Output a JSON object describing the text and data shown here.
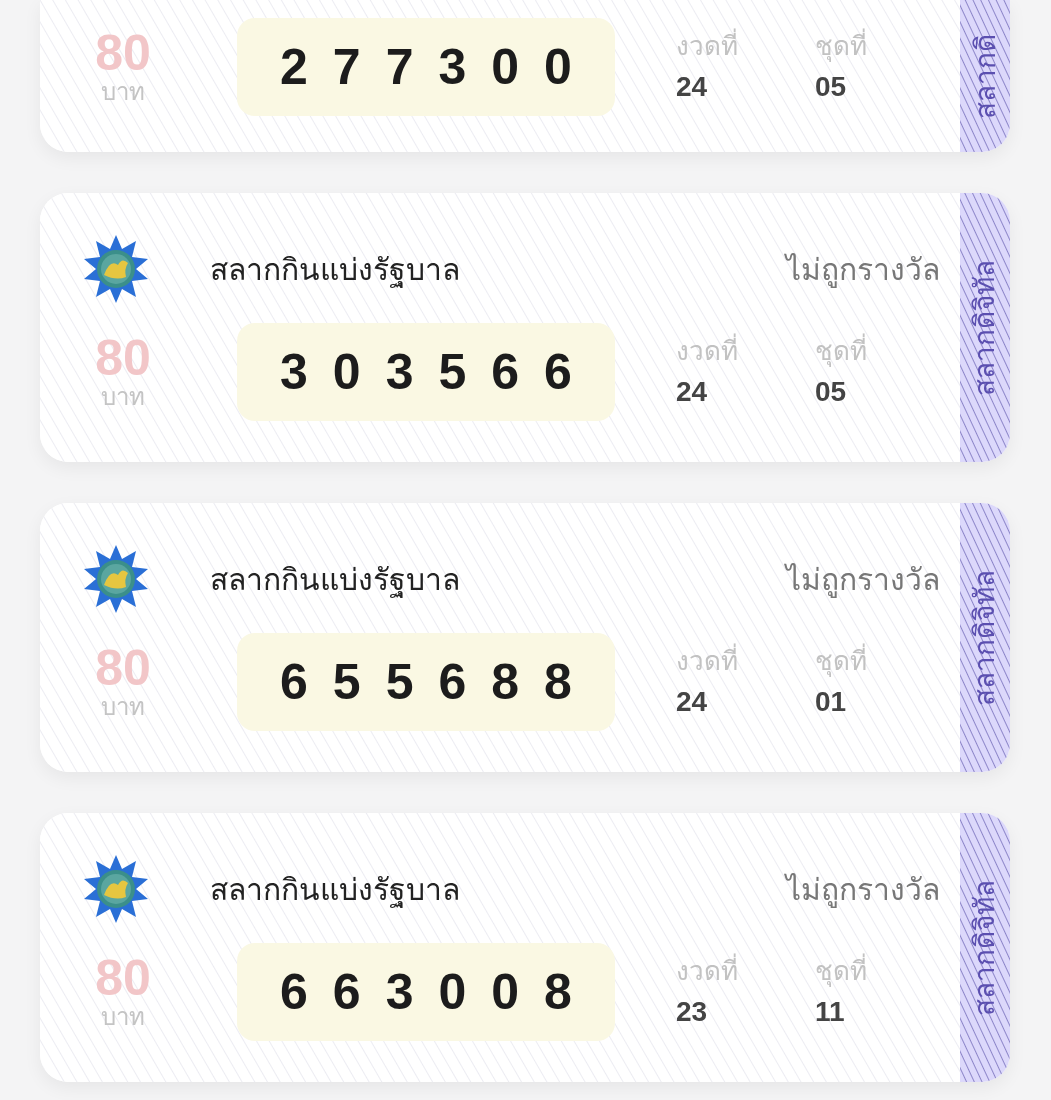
{
  "tickets": [
    {
      "price": "80",
      "currency": "บาท",
      "number": "277300",
      "draw_label": "งวดที่",
      "draw": "24",
      "set_label": "ชุดที่",
      "set": "05",
      "side_label": "สลากดิ"
    },
    {
      "title": "สลากกินแบ่งรัฐบาล",
      "status": "ไม่ถูกรางวัล",
      "price": "80",
      "currency": "บาท",
      "number": "303566",
      "draw_label": "งวดที่",
      "draw": "24",
      "set_label": "ชุดที่",
      "set": "05",
      "side_label": "สลากดิจิทัล"
    },
    {
      "title": "สลากกินแบ่งรัฐบาล",
      "status": "ไม่ถูกรางวัล",
      "price": "80",
      "currency": "บาท",
      "number": "655688",
      "draw_label": "งวดที่",
      "draw": "24",
      "set_label": "ชุดที่",
      "set": "01",
      "side_label": "สลากดิจิทัล"
    },
    {
      "title": "สลากกินแบ่งรัฐบาล",
      "status": "ไม่ถูกรางวัล",
      "price": "80",
      "currency": "บาท",
      "number": "663008",
      "draw_label": "งวดที่",
      "draw": "23",
      "set_label": "ชุดที่",
      "set": "11",
      "side_label": "สลากดิจิทัล"
    }
  ]
}
